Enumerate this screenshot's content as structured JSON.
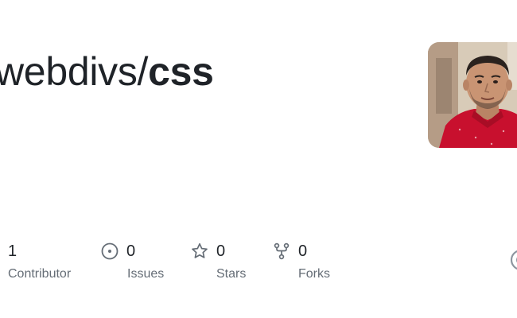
{
  "repo": {
    "owner": "webdivs",
    "separator": "/",
    "name": "css"
  },
  "avatar": {
    "alt": "webdivs avatar"
  },
  "stats": [
    {
      "count": "1",
      "label": "Contributor",
      "icon": "people-icon"
    },
    {
      "count": "0",
      "label": "Issues",
      "icon": "issue-opened-icon"
    },
    {
      "count": "0",
      "label": "Stars",
      "icon": "star-icon"
    },
    {
      "count": "0",
      "label": "Forks",
      "icon": "repo-forked-icon"
    }
  ],
  "colors": {
    "text": "#1f2328",
    "muted": "#656d76",
    "shirt": "#c8102e"
  }
}
